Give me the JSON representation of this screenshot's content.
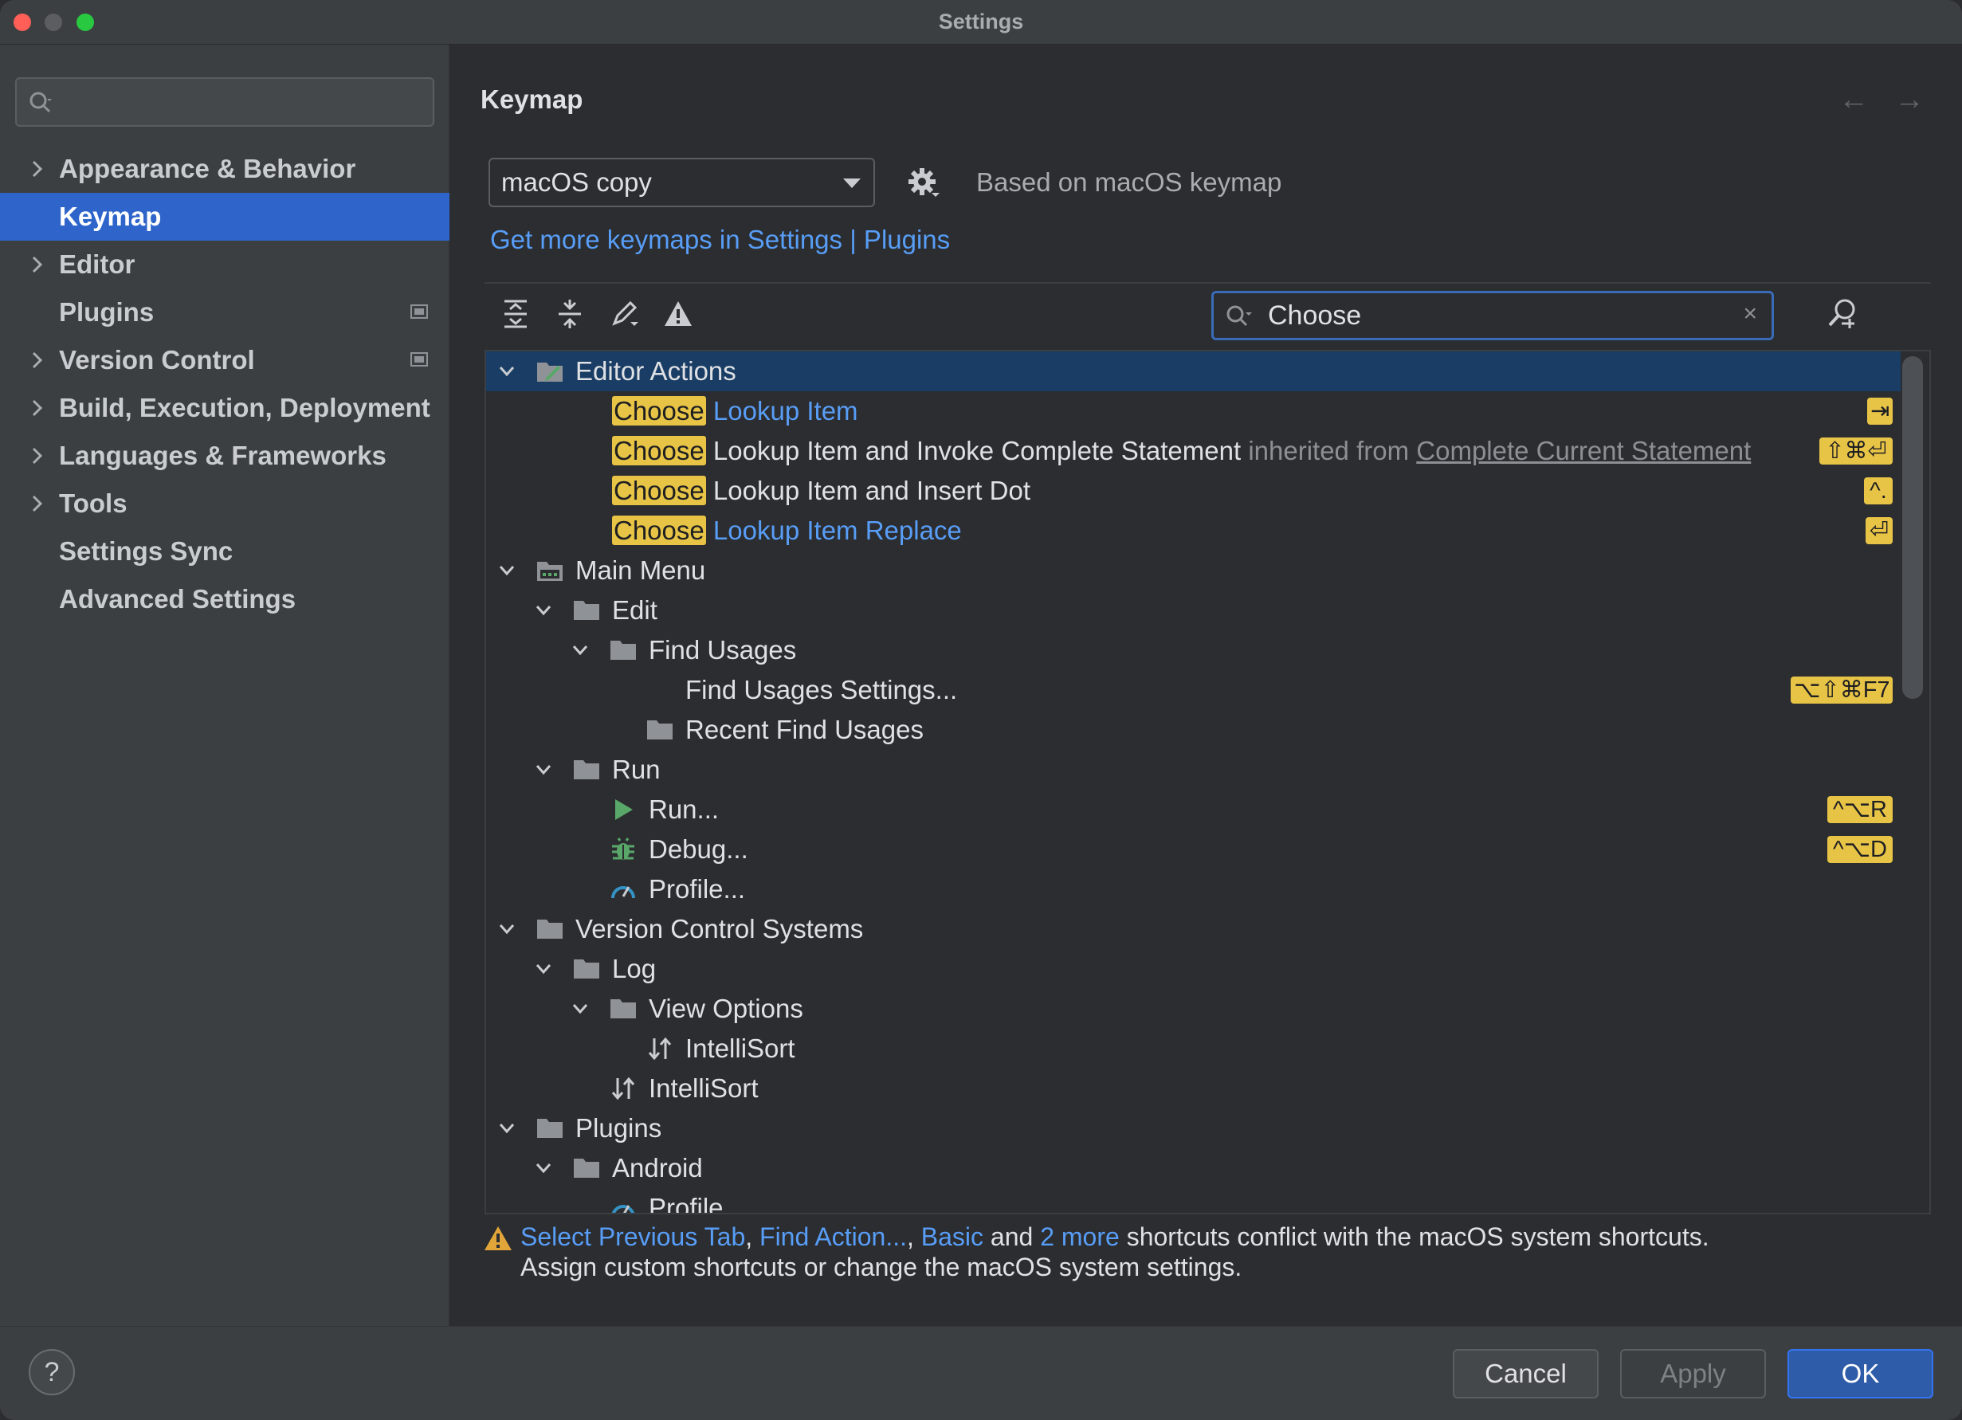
{
  "window": {
    "title": "Settings"
  },
  "sidebar": {
    "search_placeholder": "",
    "items": [
      {
        "label": "Appearance & Behavior",
        "expandable": true
      },
      {
        "label": "Keymap",
        "active": true
      },
      {
        "label": "Editor",
        "expandable": true
      },
      {
        "label": "Plugins",
        "badge": true
      },
      {
        "label": "Version Control",
        "expandable": true,
        "badge": true
      },
      {
        "label": "Build, Execution, Deployment",
        "expandable": true
      },
      {
        "label": "Languages & Frameworks",
        "expandable": true
      },
      {
        "label": "Tools",
        "expandable": true
      },
      {
        "label": "Settings Sync"
      },
      {
        "label": "Advanced Settings"
      }
    ]
  },
  "main": {
    "heading": "Keymap",
    "nav_back": "←",
    "nav_forward": "→",
    "keymap_select": "macOS copy",
    "based_on": "Based on macOS keymap",
    "more_link": "Get more keymaps in Settings | Plugins",
    "filter": {
      "value": "Choose",
      "clear": "×"
    },
    "tree": {
      "editor_actions": "Editor Actions",
      "match": "Choose",
      "lookup_item": "Lookup Item",
      "lookup_item_sc": "⇥",
      "lookup_invoke": "Lookup Item and Invoke Complete Statement",
      "inherited_from": "inherited from",
      "complete_current": "Complete Current Statement",
      "lookup_invoke_sc": "⇧⌘⏎",
      "lookup_dot": "Lookup Item and Insert Dot",
      "lookup_dot_sc": "^.",
      "lookup_replace": "Lookup Item Replace",
      "lookup_replace_sc": "⏎",
      "main_menu": "Main Menu",
      "edit": "Edit",
      "find_usages": "Find Usages",
      "find_usages_settings": "Find Usages Settings...",
      "find_usages_settings_sc": "⌥⇧⌘F7",
      "recent_find_usages": "Recent Find Usages",
      "run_group": "Run",
      "run": "Run...",
      "run_sc": "^⌥R",
      "debug": "Debug...",
      "debug_sc": "^⌥D",
      "profile": "Profile...",
      "vcs": "Version Control Systems",
      "log": "Log",
      "view_options": "View Options",
      "intellisort": "IntelliSort",
      "plugins": "Plugins",
      "android": "Android",
      "profile2": "Profile..."
    },
    "warning": {
      "link1": "Select Previous Tab",
      "sep1": ",",
      "link2": "Find Action...",
      "sep2": ",",
      "link3": "Basic",
      "and": "and",
      "link4": "2 more",
      "rest": "shortcuts conflict with the macOS system shortcuts.",
      "line2": "Assign custom shortcuts or change the macOS system settings."
    }
  },
  "footer": {
    "help": "?",
    "cancel": "Cancel",
    "apply": "Apply",
    "ok": "OK"
  },
  "colors": {
    "accent": "#2f65ca",
    "highlight": "#e8c446",
    "link": "#589df6"
  }
}
